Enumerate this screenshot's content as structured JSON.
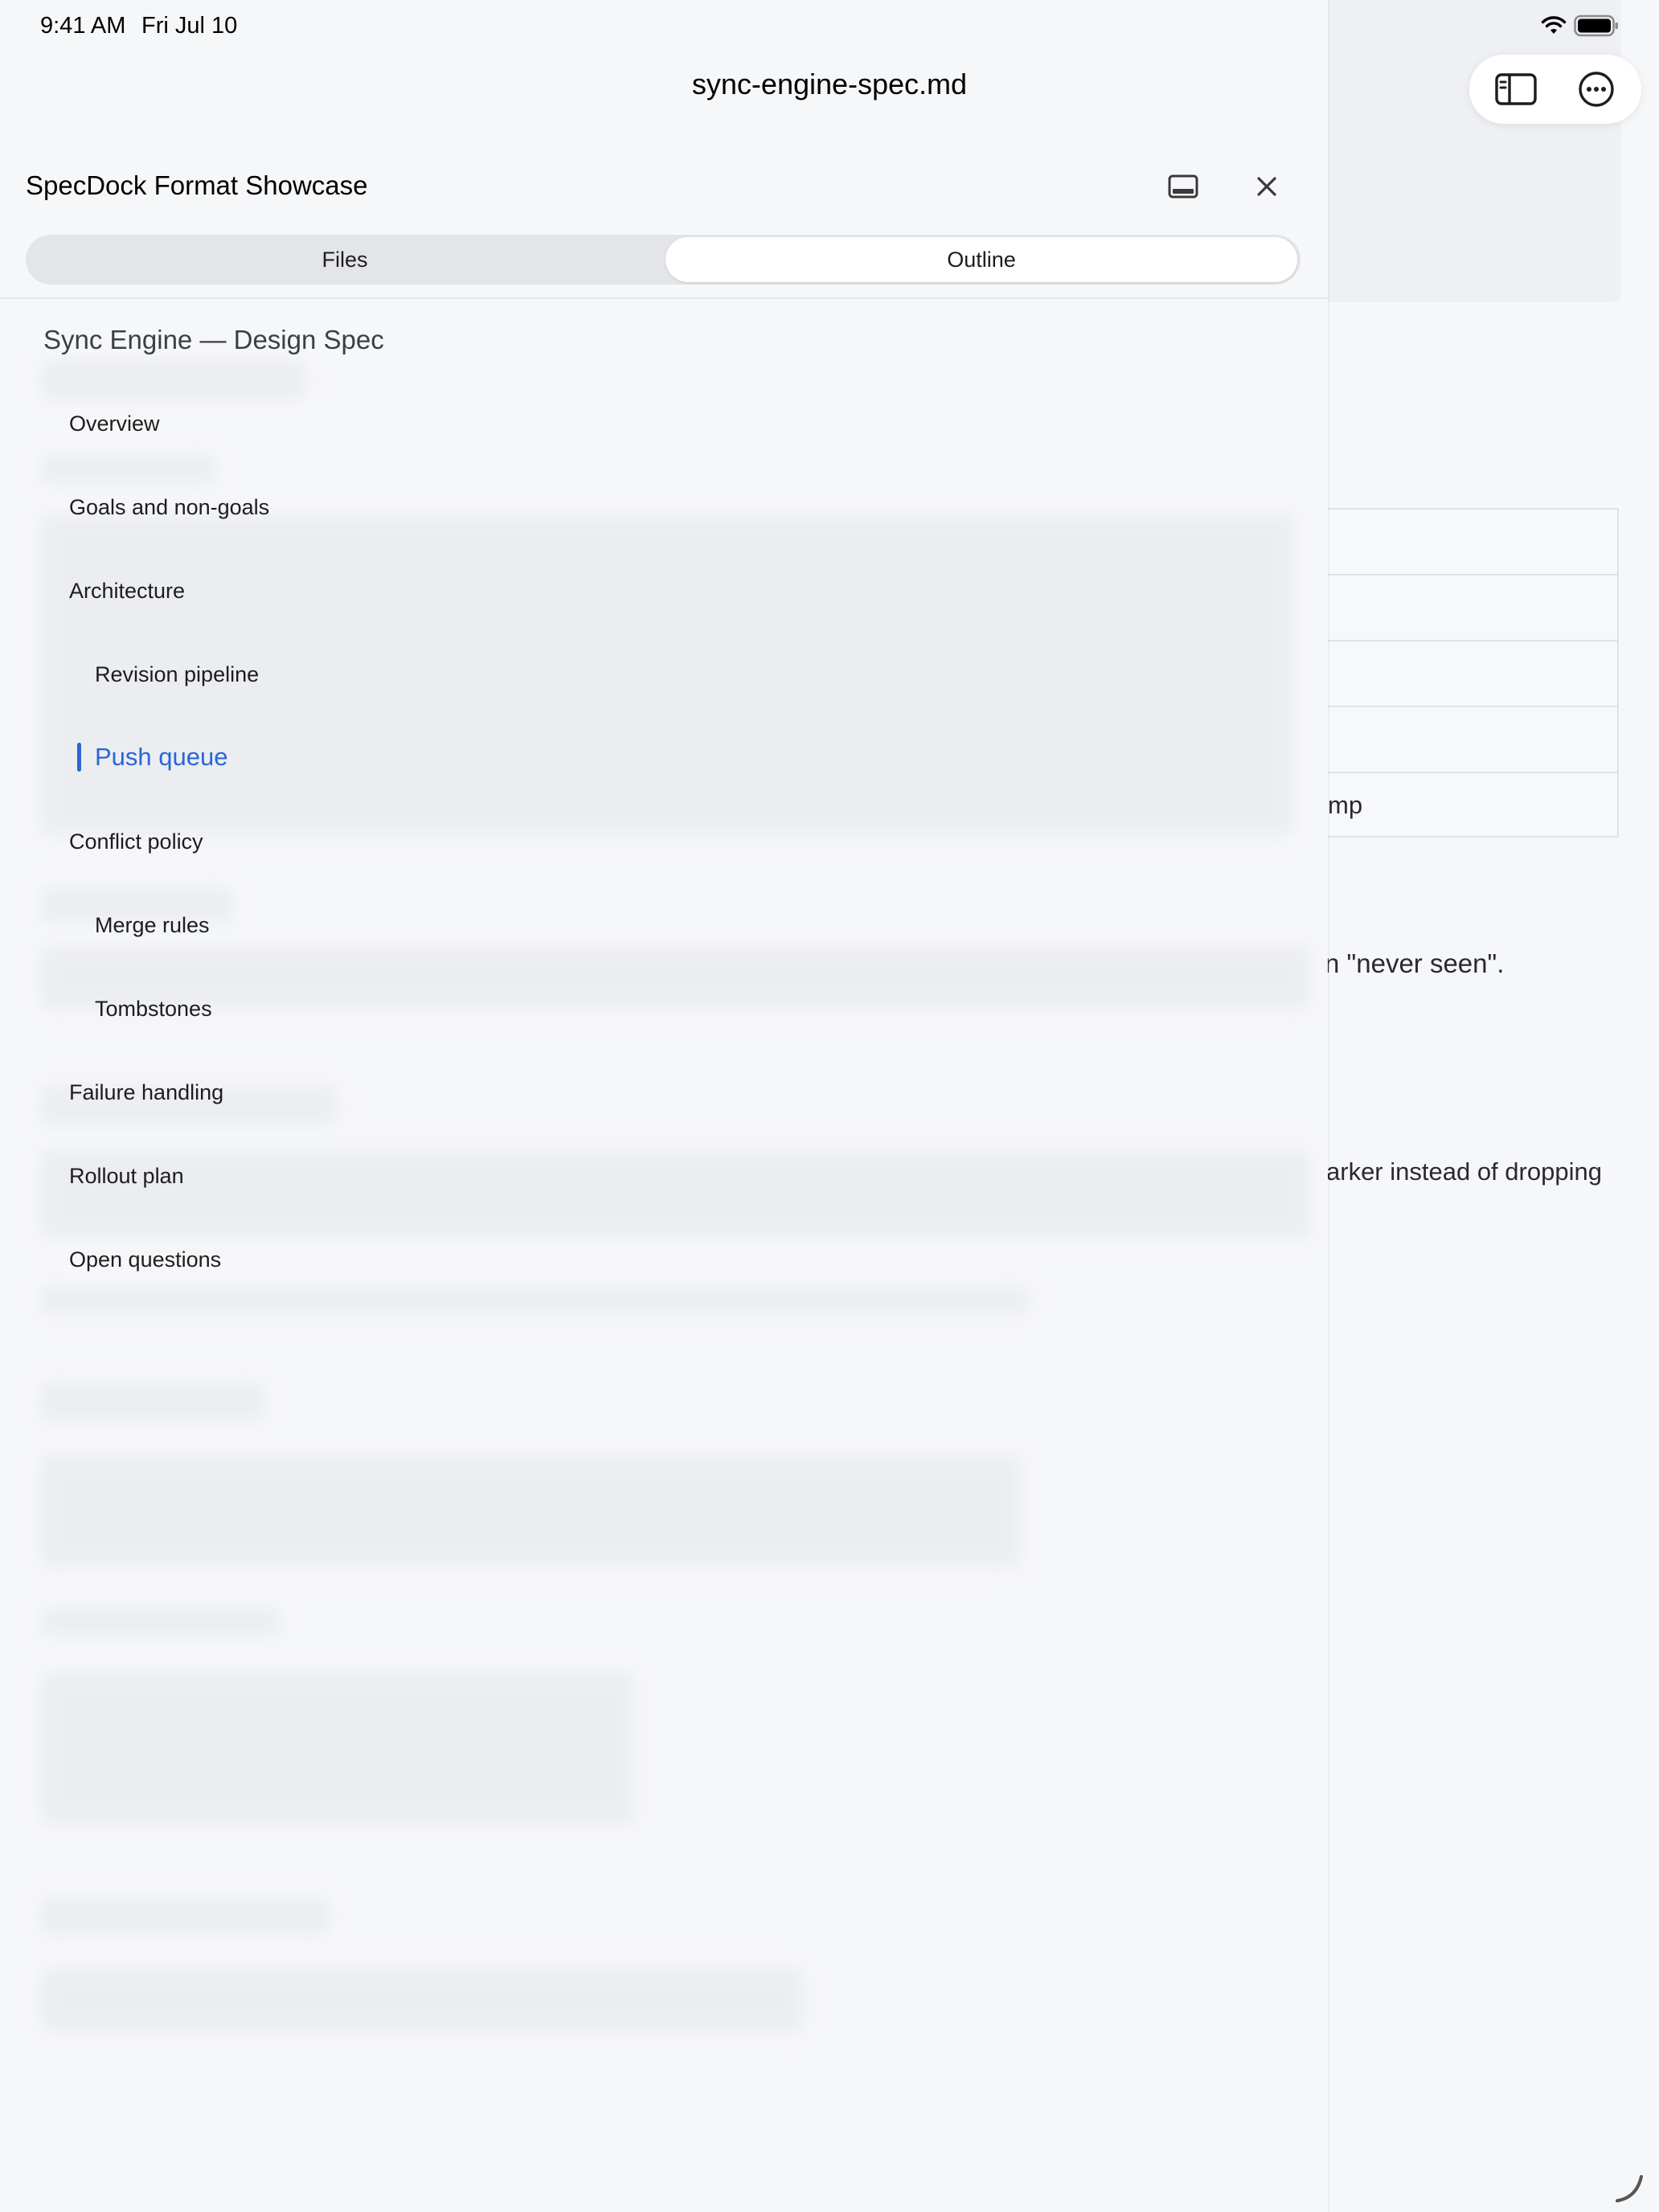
{
  "status_bar": {
    "time": "9:41 AM",
    "date": "Fri Jul 10"
  },
  "document": {
    "filename": "sync-engine-spec.md",
    "visible_fragments": {
      "table_last_cell": "mp",
      "paragraph_tail": "n \"never seen\".",
      "failure_tail": "arker instead of dropping"
    }
  },
  "toolbar": {
    "sidebar_icon": "sidebar-toggle-icon",
    "more_icon": "ellipsis-circle-icon"
  },
  "panel": {
    "title": "SpecDock Format Showcase",
    "layout_icon": "bottom-panel-icon",
    "close_icon": "close-icon",
    "tabs": {
      "files": "Files",
      "outline": "Outline",
      "selected": "Outline"
    },
    "outline": {
      "heading": "Sync Engine — Design Spec",
      "items": [
        {
          "label": "Overview",
          "level": 1
        },
        {
          "label": "Goals and non-goals",
          "level": 1
        },
        {
          "label": "Architecture",
          "level": 1
        },
        {
          "label": "Revision pipeline",
          "level": 2
        },
        {
          "label": "Push queue",
          "level": 2,
          "active": true
        },
        {
          "label": "Conflict policy",
          "level": 1
        },
        {
          "label": "Merge rules",
          "level": 2
        },
        {
          "label": "Tombstones",
          "level": 2
        },
        {
          "label": "Failure handling",
          "level": 1
        },
        {
          "label": "Rollout plan",
          "level": 1
        },
        {
          "label": "Open questions",
          "level": 1
        }
      ]
    }
  },
  "colors": {
    "accent": "#2a66d6",
    "background": "#f6f7f9"
  }
}
